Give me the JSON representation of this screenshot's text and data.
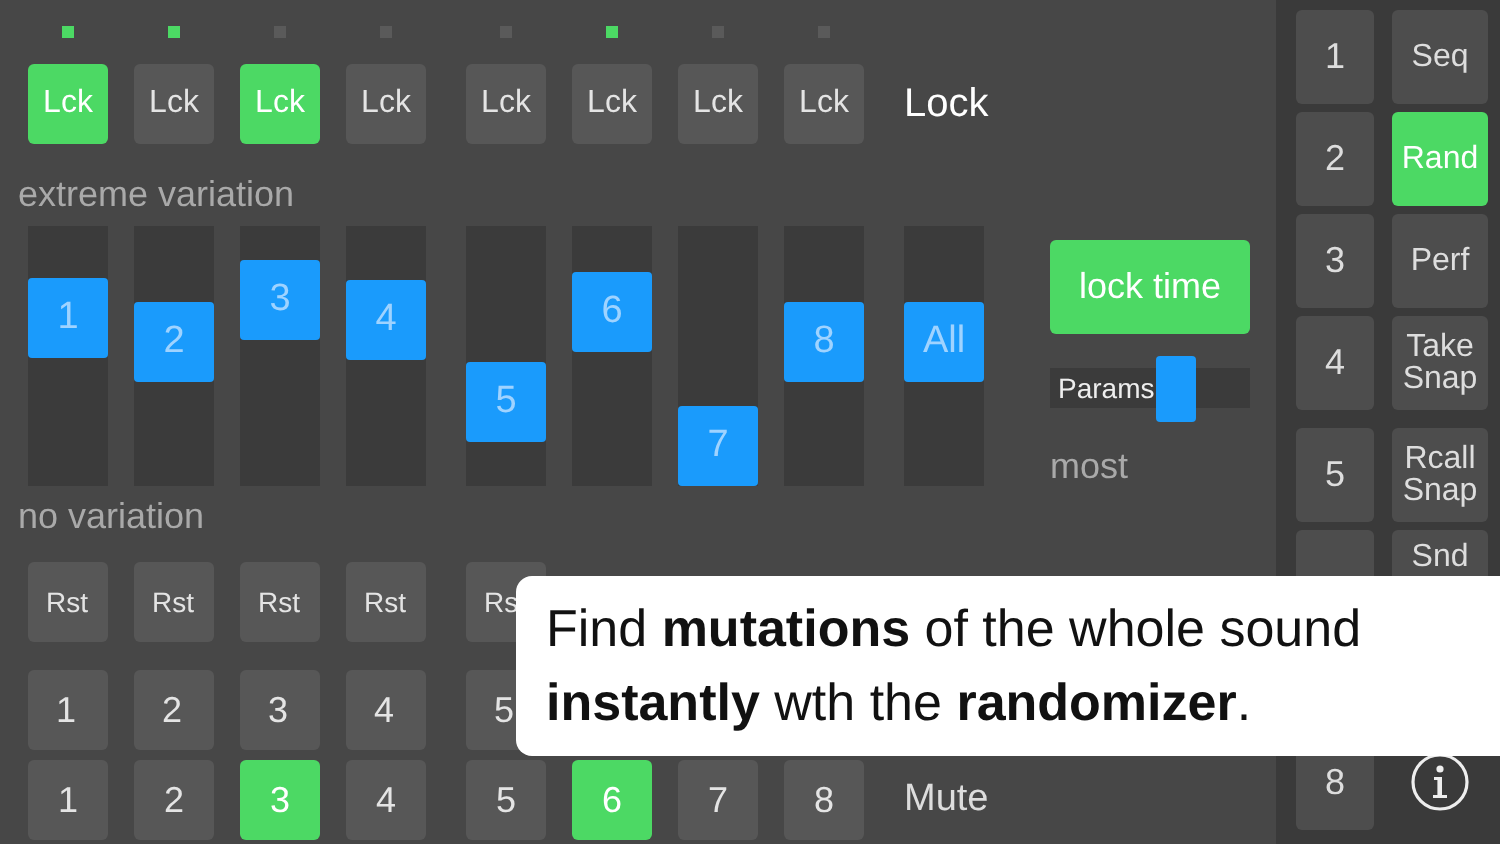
{
  "leds": [
    {
      "on": true
    },
    {
      "on": true
    },
    {
      "on": false
    },
    {
      "on": false
    },
    {
      "on": false
    },
    {
      "on": true
    },
    {
      "on": false
    },
    {
      "on": false
    }
  ],
  "lock_buttons": [
    {
      "label": "Lck",
      "selected": true
    },
    {
      "label": "Lck",
      "selected": false
    },
    {
      "label": "Lck",
      "selected": true
    },
    {
      "label": "Lck",
      "selected": false
    },
    {
      "label": "Lck",
      "selected": false
    },
    {
      "label": "Lck",
      "selected": false
    },
    {
      "label": "Lck",
      "selected": false
    },
    {
      "label": "Lck",
      "selected": false
    }
  ],
  "lock_label": "Lock",
  "top_label": "extreme variation",
  "sliders": [
    {
      "label": "1",
      "level": 0.71
    },
    {
      "label": "2",
      "level": 0.57
    },
    {
      "label": "3",
      "level": 0.81
    },
    {
      "label": "4",
      "level": 0.7
    },
    {
      "label": "5",
      "level": 0.24
    },
    {
      "label": "6",
      "level": 0.74
    },
    {
      "label": "7",
      "level": 0
    },
    {
      "label": "8",
      "level": 0.57
    },
    {
      "label": "All",
      "level": 0.57
    }
  ],
  "lock_time_button": {
    "label": "lock time",
    "on": true
  },
  "params_slider": {
    "label": "Params",
    "level": 0.66
  },
  "most_label": "most",
  "bottom_label": "no variation",
  "reset_buttons": [
    "Rst",
    "Rst",
    "Rst",
    "Rst",
    "Rs"
  ],
  "number_buttons": [
    "1",
    "2",
    "3",
    "4",
    "5"
  ],
  "mute_buttons": [
    {
      "label": "1",
      "selected": false
    },
    {
      "label": "2",
      "selected": false
    },
    {
      "label": "3",
      "selected": true
    },
    {
      "label": "4",
      "selected": false
    },
    {
      "label": "5",
      "selected": false
    },
    {
      "label": "6",
      "selected": true
    },
    {
      "label": "7",
      "selected": false
    },
    {
      "label": "8",
      "selected": false
    }
  ],
  "mute_label": "Mute",
  "side_rows": [
    {
      "number": "1",
      "mode": {
        "kind": "button",
        "label": "Seq",
        "selected": false
      }
    },
    {
      "number": "2",
      "mode": {
        "kind": "button",
        "label": "Rand",
        "selected": true
      }
    },
    {
      "number": "3",
      "mode": {
        "kind": "button",
        "label": "Perf",
        "selected": false
      }
    },
    {
      "number": "4",
      "mode": {
        "kind": "button",
        "label": "Take Snap",
        "selected": false
      }
    },
    {
      "number": "5",
      "mode": {
        "kind": "button",
        "label": "Rcall Snap",
        "selected": false
      }
    },
    {
      "mode": {
        "kind": "button",
        "label": "Snd",
        "selected": false
      }
    },
    {
      "number": "8",
      "mode": {
        "kind": "info"
      }
    }
  ],
  "caption": [
    "Find **mutations** of the whole sound",
    "**instantly** wth the **randomizer**."
  ]
}
